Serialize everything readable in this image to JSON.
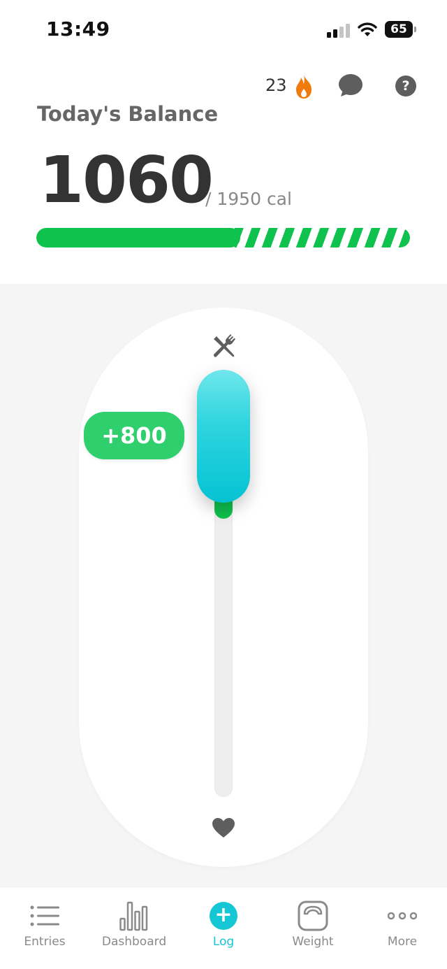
{
  "status_bar": {
    "time": "13:49",
    "battery": "65"
  },
  "header": {
    "streak_count": "23",
    "title": "Today's Balance",
    "balance": "1060",
    "goal": "/ 1950 cal",
    "consumed_fraction": 0.545,
    "planned_fraction": 0.47
  },
  "slider": {
    "amount_label": "+800",
    "filled_fraction": 0.24
  },
  "nav": {
    "items": [
      {
        "label": "Entries",
        "icon": "list-icon"
      },
      {
        "label": "Dashboard",
        "icon": "bar-chart-icon"
      },
      {
        "label": "Log",
        "icon": "plus-icon"
      },
      {
        "label": "Weight",
        "icon": "scale-icon"
      },
      {
        "label": "More",
        "icon": "more-icon"
      }
    ],
    "active": "Log"
  },
  "colors": {
    "accent": "#15c6d4",
    "green": "#0fc14d",
    "badge_green": "#2ecf6c",
    "flame": "#f07a0c",
    "icon_gray": "#5e5e5e"
  }
}
